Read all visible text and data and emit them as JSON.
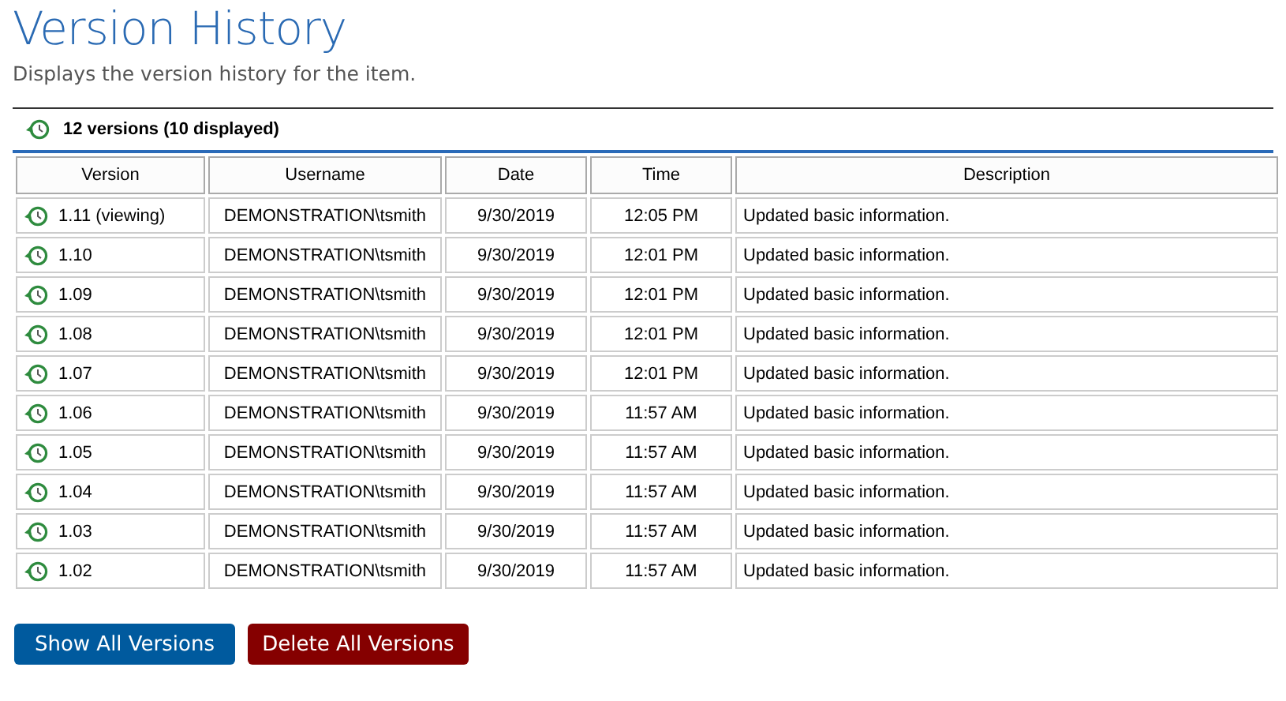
{
  "title": "Version History",
  "subtitle": "Displays the version history for the item.",
  "summary": "12 versions (10 displayed)",
  "table": {
    "columns": [
      "Version",
      "Username",
      "Date",
      "Time",
      "Description"
    ],
    "rows": [
      {
        "version": "1.11 (viewing)",
        "username": "DEMONSTRATION\\tsmith",
        "date": "9/30/2019",
        "time": "12:05 PM",
        "description": "Updated basic information."
      },
      {
        "version": "1.10",
        "username": "DEMONSTRATION\\tsmith",
        "date": "9/30/2019",
        "time": "12:01 PM",
        "description": "Updated basic information."
      },
      {
        "version": "1.09",
        "username": "DEMONSTRATION\\tsmith",
        "date": "9/30/2019",
        "time": "12:01 PM",
        "description": "Updated basic information."
      },
      {
        "version": "1.08",
        "username": "DEMONSTRATION\\tsmith",
        "date": "9/30/2019",
        "time": "12:01 PM",
        "description": "Updated basic information."
      },
      {
        "version": "1.07",
        "username": "DEMONSTRATION\\tsmith",
        "date": "9/30/2019",
        "time": "12:01 PM",
        "description": "Updated basic information."
      },
      {
        "version": "1.06",
        "username": "DEMONSTRATION\\tsmith",
        "date": "9/30/2019",
        "time": "11:57 AM",
        "description": "Updated basic information."
      },
      {
        "version": "1.05",
        "username": "DEMONSTRATION\\tsmith",
        "date": "9/30/2019",
        "time": "11:57 AM",
        "description": "Updated basic information."
      },
      {
        "version": "1.04",
        "username": "DEMONSTRATION\\tsmith",
        "date": "9/30/2019",
        "time": "11:57 AM",
        "description": "Updated basic information."
      },
      {
        "version": "1.03",
        "username": "DEMONSTRATION\\tsmith",
        "date": "9/30/2019",
        "time": "11:57 AM",
        "description": "Updated basic information."
      },
      {
        "version": "1.02",
        "username": "DEMONSTRATION\\tsmith",
        "date": "9/30/2019",
        "time": "11:57 AM",
        "description": "Updated basic information."
      }
    ]
  },
  "buttons": [
    {
      "label": "Show All Versions",
      "kind": "primary"
    },
    {
      "label": "Delete All Versions",
      "kind": "danger"
    }
  ]
}
